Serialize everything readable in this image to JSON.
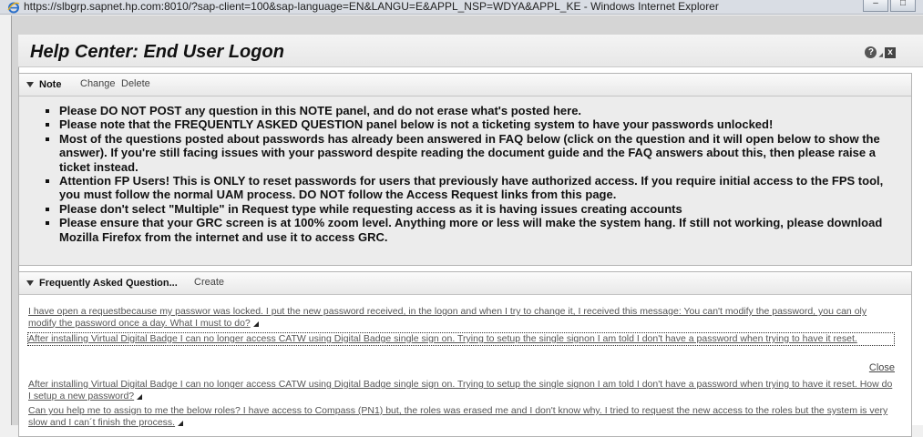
{
  "browser": {
    "title": "https://slbgrp.sapnet.hp.com:8010/?sap-client=100&sap-language=EN&LANGU=E&APPL_NSP=WDYA&APPL_KE - Windows Internet Explorer",
    "minimize": "–",
    "maximize": "□",
    "close": "×"
  },
  "header": {
    "title": "Help Center: End User Logon",
    "help_icon": "?",
    "close_icon": "x"
  },
  "note": {
    "title": "Note",
    "change": "Change",
    "delete": "Delete",
    "items": [
      "Please DO NOT POST any question in this NOTE panel, and do not erase what's posted here.",
      "Please note that the FREQUENTLY ASKED QUESTION panel below is not a ticketing system to have your passwords unlocked!",
      "Most of the questions posted about passwords has already been answered in FAQ below (click on the question and it will open below to show the answer).  If you're still facing issues with your password despite reading the document guide and the FAQ answers about this, then please raise a ticket instead.",
      "Attention FP Users! This is ONLY to reset passwords for users that previously have authorized access. If you require initial access to the FPS tool, you must follow the normal UAM process. DO NOT follow the Access Request links from this page.",
      "Please don't select \"Multiple\" in Request type while requesting access as it is having issues creating accounts",
      "Please ensure that your GRC screen is at 100% zoom level. Anything more or less will make the system hang. If still not working, please download Mozilla Firefox from the internet and use it to access GRC."
    ]
  },
  "faq": {
    "title": "Frequently Asked Question...",
    "create": "Create",
    "close": "Close",
    "items": [
      "I have open a requestbecause my passwor was locked. I put the new password received, in the logon and when I try to change it, I received this message: You can't modify the password, you can oly modify the password once a day. What I must to do?",
      "After installing Virtual Digital Badge I can no longer access CATW using Digital Badge single sign on. Trying to setup the single signon I am told I don't have a password when trying to have it reset.",
      "After installing Virtual Digital Badge I can no longer access CATW using Digital Badge single sign on. Trying to setup the single signon I am told I don't have a password when trying to have it reset. How do I setup a new password?",
      "Can you help me to assign to me the below roles? I have access to Compass (PN1) but, the roles was erased me and I don't know why. I tried to request the new access to the roles but the system is very slow and I can´t finish the process."
    ]
  }
}
